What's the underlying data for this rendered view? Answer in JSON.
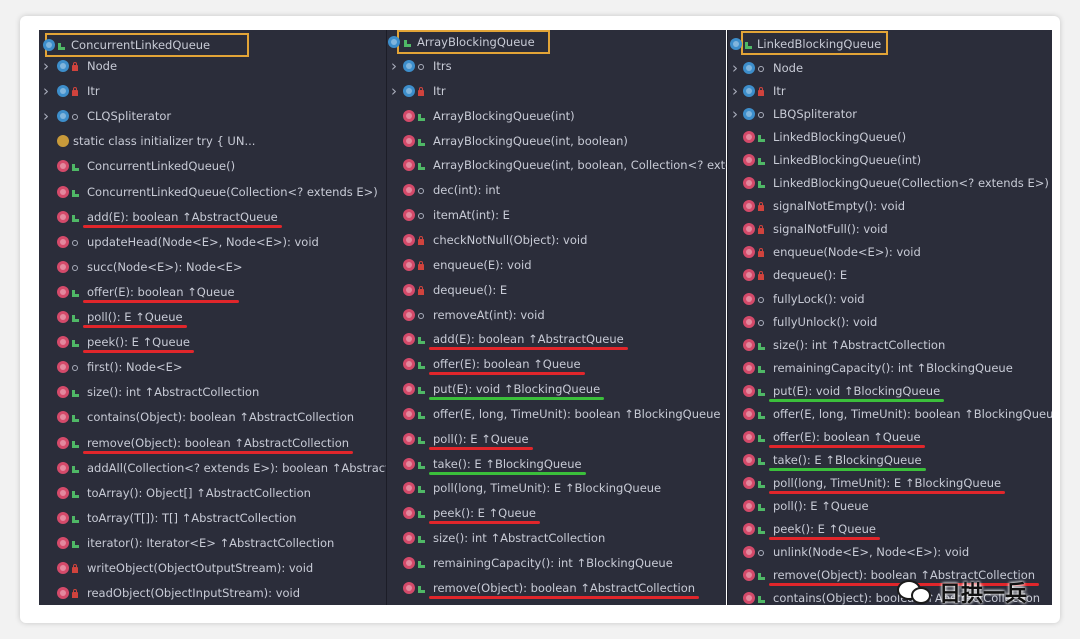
{
  "panels": [
    {
      "id": "p1",
      "title": "ConcurrentLinkedQueue",
      "rows": [
        {
          "arrow": true,
          "icon": "c",
          "vis": "pri",
          "label": "Node"
        },
        {
          "arrow": true,
          "icon": "c",
          "vis": "pri",
          "label": "Itr"
        },
        {
          "arrow": true,
          "icon": "c",
          "vis": "pkg",
          "label": "CLQSpliterator"
        },
        {
          "arrow": false,
          "icon": "s",
          "vis": "none",
          "label": "static class initializer  try {            UN..."
        },
        {
          "arrow": false,
          "icon": "m",
          "vis": "pub",
          "label": "ConcurrentLinkedQueue()"
        },
        {
          "arrow": false,
          "icon": "m",
          "vis": "pub",
          "label": "ConcurrentLinkedQueue(Collection<? extends E>)"
        },
        {
          "arrow": false,
          "icon": "m",
          "vis": "pub",
          "label": "add(E): boolean ↑AbstractQueue",
          "underline": "red"
        },
        {
          "arrow": false,
          "icon": "m",
          "vis": "pkg",
          "label": "updateHead(Node<E>, Node<E>): void"
        },
        {
          "arrow": false,
          "icon": "m",
          "vis": "pkg",
          "label": "succ(Node<E>): Node<E>"
        },
        {
          "arrow": false,
          "icon": "m",
          "vis": "pub",
          "label": "offer(E): boolean ↑Queue",
          "underline": "red"
        },
        {
          "arrow": false,
          "icon": "m",
          "vis": "pub",
          "label": "poll(): E ↑Queue",
          "underline": "red"
        },
        {
          "arrow": false,
          "icon": "m",
          "vis": "pub",
          "label": "peek(): E ↑Queue",
          "underline": "red"
        },
        {
          "arrow": false,
          "icon": "m",
          "vis": "pkg",
          "label": "first(): Node<E>"
        },
        {
          "arrow": false,
          "icon": "m",
          "vis": "pub",
          "label": "size(): int ↑AbstractCollection"
        },
        {
          "arrow": false,
          "icon": "m",
          "vis": "pub",
          "label": "contains(Object): boolean ↑AbstractCollection"
        },
        {
          "arrow": false,
          "icon": "m",
          "vis": "pub",
          "label": "remove(Object): boolean ↑AbstractCollection",
          "underline": "red"
        },
        {
          "arrow": false,
          "icon": "m",
          "vis": "pub",
          "label": "addAll(Collection<? extends E>): boolean ↑Abstract"
        },
        {
          "arrow": false,
          "icon": "m",
          "vis": "pub",
          "label": "toArray(): Object[] ↑AbstractCollection"
        },
        {
          "arrow": false,
          "icon": "m",
          "vis": "pub",
          "label": "toArray(T[]): T[] ↑AbstractCollection"
        },
        {
          "arrow": false,
          "icon": "m",
          "vis": "pub",
          "label": "iterator(): Iterator<E> ↑AbstractCollection"
        },
        {
          "arrow": false,
          "icon": "m",
          "vis": "pri",
          "label": "writeObject(ObjectOutputStream): void"
        },
        {
          "arrow": false,
          "icon": "m",
          "vis": "pri",
          "label": "readObject(ObjectInputStream): void"
        }
      ]
    },
    {
      "id": "p2",
      "title": "ArrayBlockingQueue",
      "rows": [
        {
          "arrow": true,
          "icon": "c",
          "vis": "pkg",
          "label": "Itrs"
        },
        {
          "arrow": true,
          "icon": "c",
          "vis": "pri",
          "label": "Itr"
        },
        {
          "arrow": false,
          "icon": "m",
          "vis": "pub",
          "label": "ArrayBlockingQueue(int)"
        },
        {
          "arrow": false,
          "icon": "m",
          "vis": "pub",
          "label": "ArrayBlockingQueue(int, boolean)"
        },
        {
          "arrow": false,
          "icon": "m",
          "vis": "pub",
          "label": "ArrayBlockingQueue(int, boolean, Collection<? exter"
        },
        {
          "arrow": false,
          "icon": "m",
          "vis": "pkg",
          "label": "dec(int): int"
        },
        {
          "arrow": false,
          "icon": "m",
          "vis": "pkg",
          "label": "itemAt(int): E"
        },
        {
          "arrow": false,
          "icon": "m",
          "vis": "pri",
          "label": "checkNotNull(Object): void"
        },
        {
          "arrow": false,
          "icon": "m",
          "vis": "pri",
          "label": "enqueue(E): void"
        },
        {
          "arrow": false,
          "icon": "m",
          "vis": "pri",
          "label": "dequeue(): E"
        },
        {
          "arrow": false,
          "icon": "m",
          "vis": "pkg",
          "label": "removeAt(int): void"
        },
        {
          "arrow": false,
          "icon": "m",
          "vis": "pub",
          "label": "add(E): boolean ↑AbstractQueue",
          "underline": "red"
        },
        {
          "arrow": false,
          "icon": "m",
          "vis": "pub",
          "label": "offer(E): boolean ↑Queue",
          "underline": "red"
        },
        {
          "arrow": false,
          "icon": "m",
          "vis": "pub",
          "label": "put(E): void ↑BlockingQueue",
          "underline": "green"
        },
        {
          "arrow": false,
          "icon": "m",
          "vis": "pub",
          "label": "offer(E, long, TimeUnit): boolean ↑BlockingQueue"
        },
        {
          "arrow": false,
          "icon": "m",
          "vis": "pub",
          "label": "poll(): E ↑Queue",
          "underline": "red"
        },
        {
          "arrow": false,
          "icon": "m",
          "vis": "pub",
          "label": "take(): E ↑BlockingQueue",
          "underline": "green"
        },
        {
          "arrow": false,
          "icon": "m",
          "vis": "pub",
          "label": "poll(long, TimeUnit): E ↑BlockingQueue"
        },
        {
          "arrow": false,
          "icon": "m",
          "vis": "pub",
          "label": "peek(): E ↑Queue",
          "underline": "red"
        },
        {
          "arrow": false,
          "icon": "m",
          "vis": "pub",
          "label": "size(): int ↑AbstractCollection"
        },
        {
          "arrow": false,
          "icon": "m",
          "vis": "pub",
          "label": "remainingCapacity(): int ↑BlockingQueue"
        },
        {
          "arrow": false,
          "icon": "m",
          "vis": "pub",
          "label": "remove(Object): boolean ↑AbstractCollection",
          "underline": "red"
        }
      ]
    },
    {
      "id": "p3",
      "title": "LinkedBlockingQueue",
      "rows": [
        {
          "arrow": true,
          "icon": "c",
          "vis": "pkg",
          "label": "Node"
        },
        {
          "arrow": true,
          "icon": "c",
          "vis": "pri",
          "label": "Itr"
        },
        {
          "arrow": true,
          "icon": "c",
          "vis": "pkg",
          "label": "LBQSpliterator"
        },
        {
          "arrow": false,
          "icon": "m",
          "vis": "pub",
          "label": "LinkedBlockingQueue()"
        },
        {
          "arrow": false,
          "icon": "m",
          "vis": "pub",
          "label": "LinkedBlockingQueue(int)"
        },
        {
          "arrow": false,
          "icon": "m",
          "vis": "pub",
          "label": "LinkedBlockingQueue(Collection<? extends E>)"
        },
        {
          "arrow": false,
          "icon": "m",
          "vis": "pri",
          "label": "signalNotEmpty(): void"
        },
        {
          "arrow": false,
          "icon": "m",
          "vis": "pri",
          "label": "signalNotFull(): void"
        },
        {
          "arrow": false,
          "icon": "m",
          "vis": "pri",
          "label": "enqueue(Node<E>): void"
        },
        {
          "arrow": false,
          "icon": "m",
          "vis": "pri",
          "label": "dequeue(): E"
        },
        {
          "arrow": false,
          "icon": "m",
          "vis": "pkg",
          "label": "fullyLock(): void"
        },
        {
          "arrow": false,
          "icon": "m",
          "vis": "pkg",
          "label": "fullyUnlock(): void"
        },
        {
          "arrow": false,
          "icon": "m",
          "vis": "pub",
          "label": "size(): int ↑AbstractCollection"
        },
        {
          "arrow": false,
          "icon": "m",
          "vis": "pub",
          "label": "remainingCapacity(): int ↑BlockingQueue"
        },
        {
          "arrow": false,
          "icon": "m",
          "vis": "pub",
          "label": "put(E): void ↑BlockingQueue",
          "underline": "green"
        },
        {
          "arrow": false,
          "icon": "m",
          "vis": "pub",
          "label": "offer(E, long, TimeUnit): boolean ↑BlockingQueue"
        },
        {
          "arrow": false,
          "icon": "m",
          "vis": "pub",
          "label": "offer(E): boolean ↑Queue",
          "underline": "red"
        },
        {
          "arrow": false,
          "icon": "m",
          "vis": "pub",
          "label": "take(): E ↑BlockingQueue",
          "underline": "green"
        },
        {
          "arrow": false,
          "icon": "m",
          "vis": "pub",
          "label": "poll(long, TimeUnit): E ↑BlockingQueue",
          "underline": "red"
        },
        {
          "arrow": false,
          "icon": "m",
          "vis": "pub",
          "label": "poll(): E ↑Queue"
        },
        {
          "arrow": false,
          "icon": "m",
          "vis": "pub",
          "label": "peek(): E ↑Queue",
          "underline": "red"
        },
        {
          "arrow": false,
          "icon": "m",
          "vis": "pkg",
          "label": "unlink(Node<E>, Node<E>): void"
        },
        {
          "arrow": false,
          "icon": "m",
          "vis": "pub",
          "label": "remove(Object): boolean ↑AbstractCollection",
          "underline": "red"
        },
        {
          "arrow": false,
          "icon": "m",
          "vis": "pub",
          "label": "contains(Object): boolean ↑AbstractCollection"
        }
      ]
    }
  ],
  "watermark": {
    "text": "日拱一兵",
    "icon": "wechat-icon"
  },
  "colors": {
    "panel_bg": "#2b2d3a",
    "title_box": "#e2a437",
    "underline_red": "#e1262b",
    "underline_green": "#3bbf3b"
  }
}
